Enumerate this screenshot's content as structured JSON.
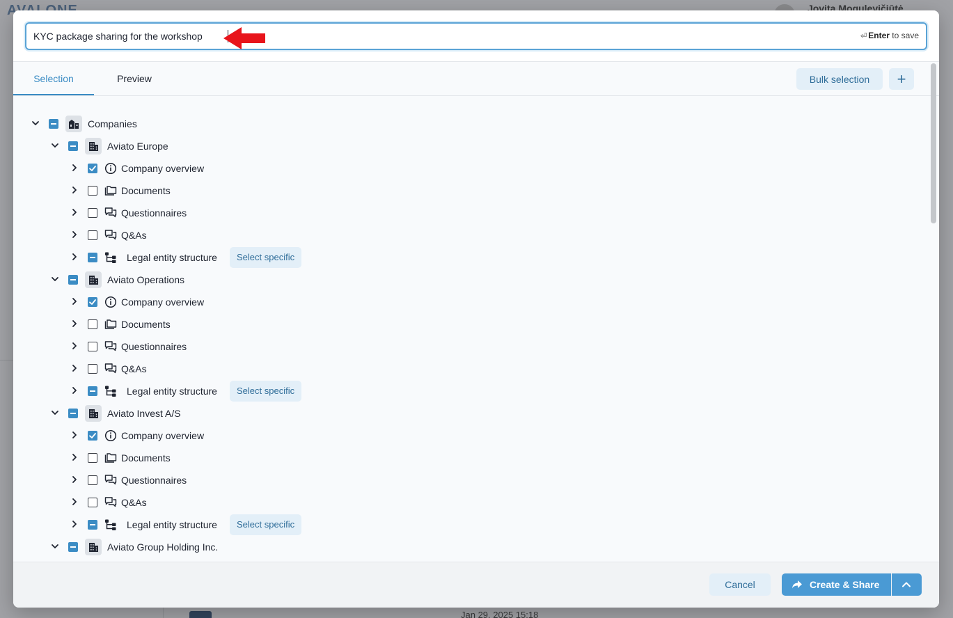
{
  "background": {
    "logo_text": "AVALONE",
    "user_name": "Jovita Mogulevičiūtė",
    "row_date": "Jan 29, 2025 15:18"
  },
  "title_input": {
    "value": "KYC package sharing for the workshop",
    "enter_glyph": "⏎",
    "enter_key": "Enter",
    "enter_suffix": "to save"
  },
  "tabs": {
    "selection": "Selection",
    "preview": "Preview"
  },
  "toolbar": {
    "bulk_label": "Bulk selection",
    "plus_label": "+"
  },
  "tree": {
    "root_label": "Companies",
    "select_specific_label": "Select specific",
    "companies": [
      {
        "name": "Aviato Europe",
        "items": {
          "overview": "Company overview",
          "documents": "Documents",
          "questionnaires": "Questionnaires",
          "qas": "Q&As",
          "legal": "Legal entity structure"
        }
      },
      {
        "name": "Aviato Operations",
        "items": {
          "overview": "Company overview",
          "documents": "Documents",
          "questionnaires": "Questionnaires",
          "qas": "Q&As",
          "legal": "Legal entity structure"
        }
      },
      {
        "name": "Aviato Invest A/S",
        "items": {
          "overview": "Company overview",
          "documents": "Documents",
          "questionnaires": "Questionnaires",
          "qas": "Q&As",
          "legal": "Legal entity structure"
        }
      },
      {
        "name": "Aviato Group Holding Inc."
      }
    ]
  },
  "footer": {
    "cancel_label": "Cancel",
    "share_label": "Create & Share"
  },
  "colors": {
    "accent": "#3b8cc4",
    "primary_button": "#4a9ad4",
    "soft_button": "#e3eff8",
    "annotation_arrow": "#e8141b"
  }
}
